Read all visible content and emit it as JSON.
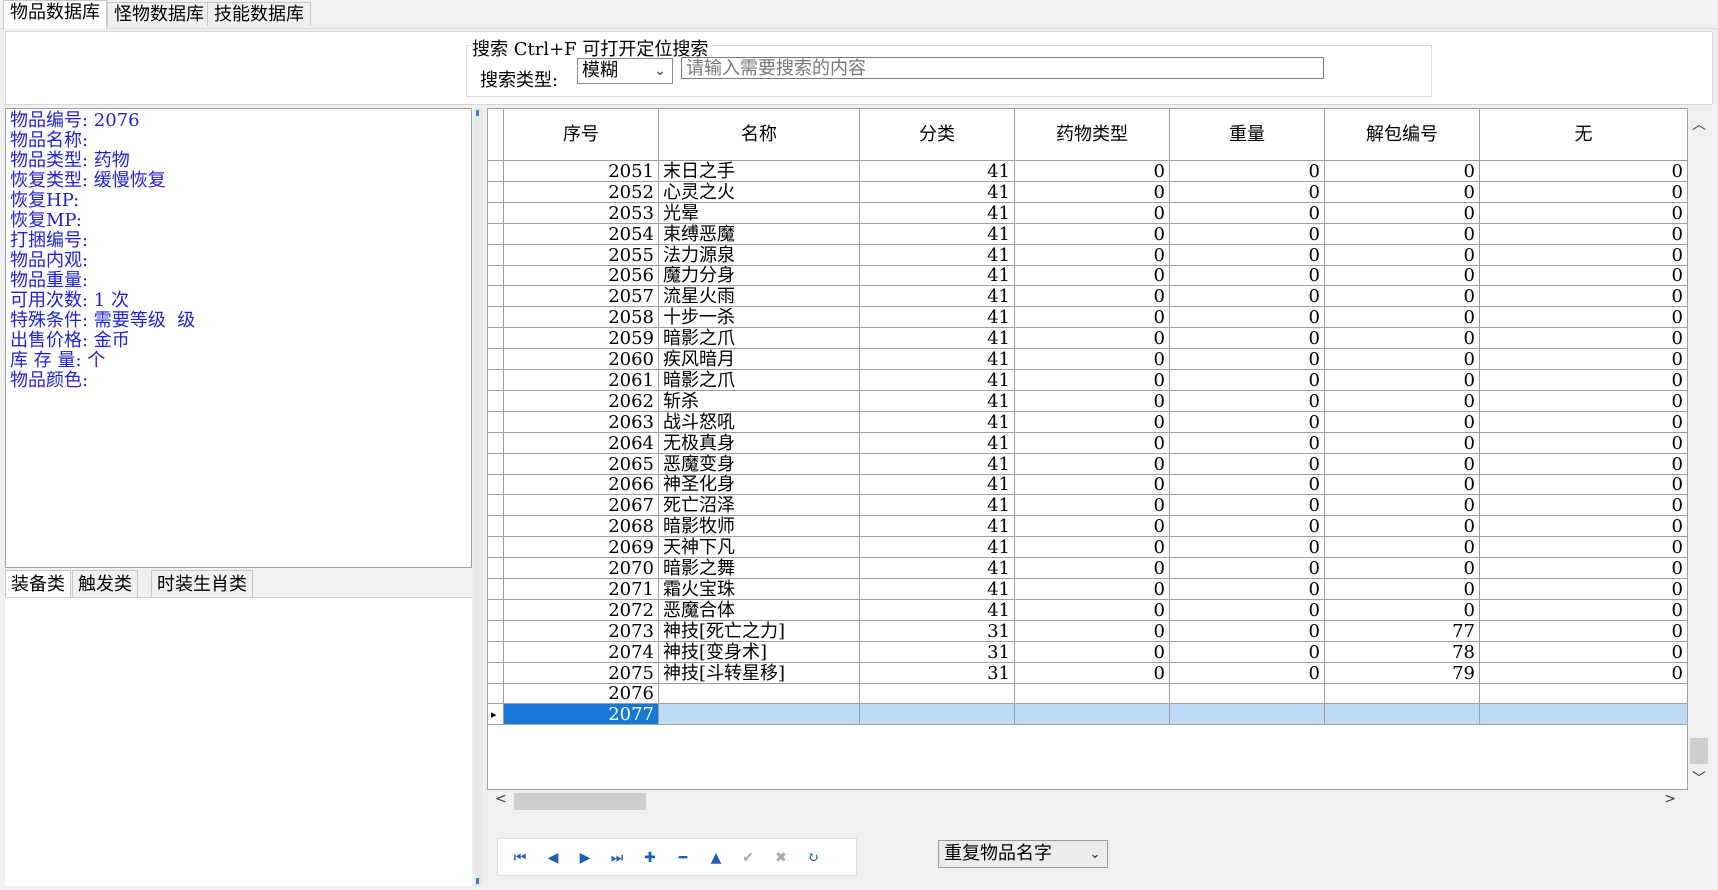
{
  "top_tabs": [
    {
      "label": "物品数据库",
      "active": true
    },
    {
      "label": "怪物数据库",
      "active": false
    },
    {
      "label": "技能数据库",
      "active": false
    }
  ],
  "search": {
    "title": "搜索  Ctrl+F 可打开定位搜索",
    "type_label": "搜索类型:",
    "type_value": "模糊",
    "placeholder": "请输入需要搜索的内容",
    "value": ""
  },
  "info": {
    "lines": [
      "物品编号: 2076",
      "物品名称:",
      "物品类型: 药物",
      "恢复类型: 缓慢恢复",
      "恢复HP:",
      "恢复MP:",
      "打捆编号:",
      "物品内观:",
      "物品重量:",
      "可用次数: 1 次",
      "特殊条件: 需要等级  级",
      "出售价格: 金币",
      "库 存 量: 个",
      "物品颜色:"
    ]
  },
  "lower_tabs": [
    {
      "label": "装备类",
      "active": true
    },
    {
      "label": "触发类",
      "active": false
    },
    {
      "label": "时装生肖类",
      "active": false
    }
  ],
  "grid": {
    "columns": [
      "序号",
      "名称",
      "分类",
      "药物类型",
      "重量",
      "解包编号",
      "无"
    ],
    "rows": [
      [
        "2051",
        "末日之手",
        "41",
        "0",
        "0",
        "0",
        "0"
      ],
      [
        "2052",
        "心灵之火",
        "41",
        "0",
        "0",
        "0",
        "0"
      ],
      [
        "2053",
        "光晕",
        "41",
        "0",
        "0",
        "0",
        "0"
      ],
      [
        "2054",
        "束缚恶魔",
        "41",
        "0",
        "0",
        "0",
        "0"
      ],
      [
        "2055",
        "法力源泉",
        "41",
        "0",
        "0",
        "0",
        "0"
      ],
      [
        "2056",
        "魔力分身",
        "41",
        "0",
        "0",
        "0",
        "0"
      ],
      [
        "2057",
        "流星火雨",
        "41",
        "0",
        "0",
        "0",
        "0"
      ],
      [
        "2058",
        "十步一杀",
        "41",
        "0",
        "0",
        "0",
        "0"
      ],
      [
        "2059",
        "暗影之爪",
        "41",
        "0",
        "0",
        "0",
        "0"
      ],
      [
        "2060",
        "疾风暗月",
        "41",
        "0",
        "0",
        "0",
        "0"
      ],
      [
        "2061",
        "暗影之爪",
        "41",
        "0",
        "0",
        "0",
        "0"
      ],
      [
        "2062",
        "斩杀",
        "41",
        "0",
        "0",
        "0",
        "0"
      ],
      [
        "2063",
        "战斗怒吼",
        "41",
        "0",
        "0",
        "0",
        "0"
      ],
      [
        "2064",
        "无极真身",
        "41",
        "0",
        "0",
        "0",
        "0"
      ],
      [
        "2065",
        "恶魔变身",
        "41",
        "0",
        "0",
        "0",
        "0"
      ],
      [
        "2066",
        "神圣化身",
        "41",
        "0",
        "0",
        "0",
        "0"
      ],
      [
        "2067",
        "死亡沼泽",
        "41",
        "0",
        "0",
        "0",
        "0"
      ],
      [
        "2068",
        "暗影牧师",
        "41",
        "0",
        "0",
        "0",
        "0"
      ],
      [
        "2069",
        "天神下凡",
        "41",
        "0",
        "0",
        "0",
        "0"
      ],
      [
        "2070",
        "暗影之舞",
        "41",
        "0",
        "0",
        "0",
        "0"
      ],
      [
        "2071",
        "霜火宝珠",
        "41",
        "0",
        "0",
        "0",
        "0"
      ],
      [
        "2072",
        "恶魔合体",
        "41",
        "0",
        "0",
        "0",
        "0"
      ],
      [
        "2073",
        "神技[死亡之力]",
        "31",
        "0",
        "0",
        "77",
        "0"
      ],
      [
        "2074",
        "神技[变身术]",
        "31",
        "0",
        "0",
        "78",
        "0"
      ],
      [
        "2075",
        "神技[斗转星移]",
        "31",
        "0",
        "0",
        "79",
        "0"
      ],
      [
        "2076",
        "",
        "",
        "",
        "",
        "",
        ""
      ],
      [
        "2077",
        "",
        "",
        "",
        "",
        "",
        ""
      ]
    ],
    "selected_row": 26
  },
  "navigator": {
    "buttons": [
      {
        "name": "first-record-icon",
        "glyph": "⏮",
        "enabled": true
      },
      {
        "name": "prior-record-icon",
        "glyph": "◀",
        "enabled": true
      },
      {
        "name": "next-record-icon",
        "glyph": "▶",
        "enabled": true
      },
      {
        "name": "last-record-icon",
        "glyph": "⏭",
        "enabled": true
      },
      {
        "name": "insert-record-icon",
        "glyph": "✚",
        "enabled": true
      },
      {
        "name": "delete-record-icon",
        "glyph": "━",
        "enabled": true
      },
      {
        "name": "edit-record-icon",
        "glyph": "▲",
        "enabled": true
      },
      {
        "name": "post-record-icon",
        "glyph": "✔",
        "enabled": false
      },
      {
        "name": "cancel-record-icon",
        "glyph": "✖",
        "enabled": false
      },
      {
        "name": "refresh-icon",
        "glyph": "↻",
        "enabled": true
      }
    ]
  },
  "dup_select": {
    "value": "重复物品名字"
  },
  "colors": {
    "info_text": "#1f1fd6",
    "selection": "#1679d5",
    "selection_row": "#bfdcf6"
  }
}
